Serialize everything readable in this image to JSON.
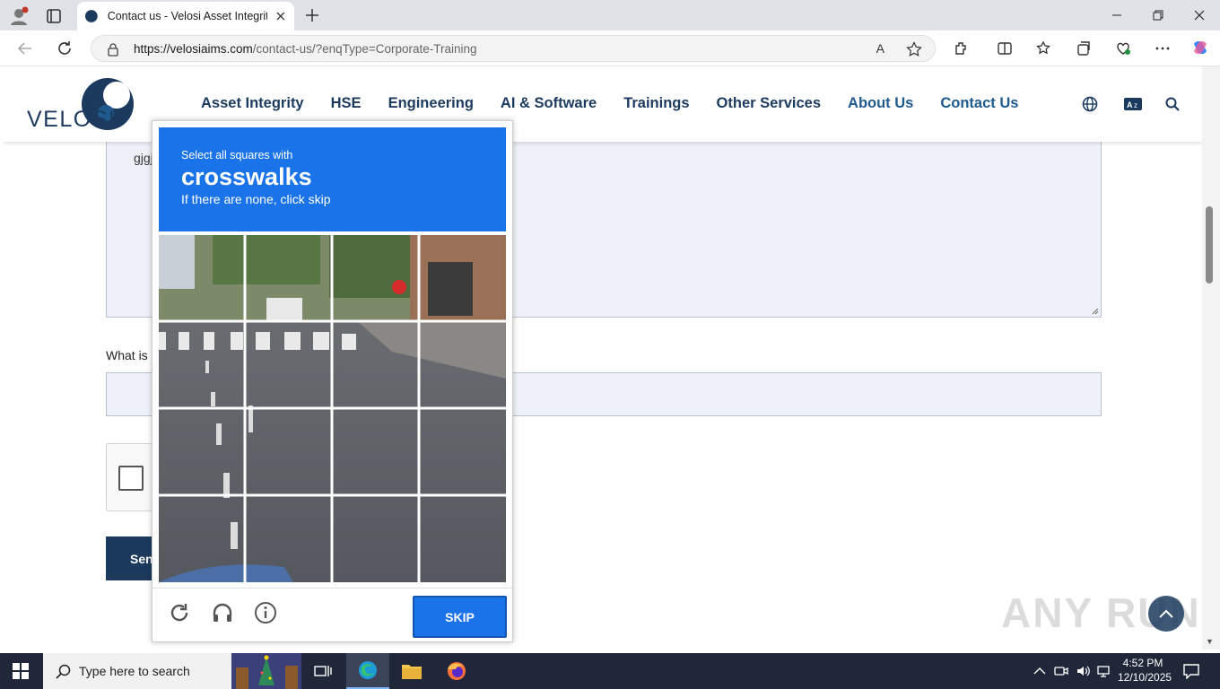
{
  "browser": {
    "tab_title": "Contact us - Velosi Asset Integrity",
    "url_host": "https://velosiaims.com",
    "url_path": "/contact-us/?enqType=Corporate-Training",
    "read_aloud_label": "A"
  },
  "site": {
    "logo_text": "VELOSI",
    "nav": [
      {
        "label": "Asset Integrity"
      },
      {
        "label": "HSE"
      },
      {
        "label": "Engineering"
      },
      {
        "label": "AI & Software"
      },
      {
        "label": "Trainings"
      },
      {
        "label": "Other Services"
      },
      {
        "label": "About Us"
      },
      {
        "label": "Contact Us"
      }
    ],
    "message_text": "gjgj",
    "question_label": "What is",
    "send_label": "Sen"
  },
  "captcha": {
    "instruction": "Select all squares with",
    "target": "crosswalks",
    "hint": "If there are none, click skip",
    "skip_label": "SKIP",
    "grid_size": 4
  },
  "watermark": "ANY RUN",
  "taskbar": {
    "search_placeholder": "Type here to search",
    "time": "4:52 PM",
    "date": "12/10/2025"
  },
  "colors": {
    "brand_navy": "#1c3a5e",
    "captcha_blue": "#1a73e8",
    "taskbar": "#202738"
  }
}
